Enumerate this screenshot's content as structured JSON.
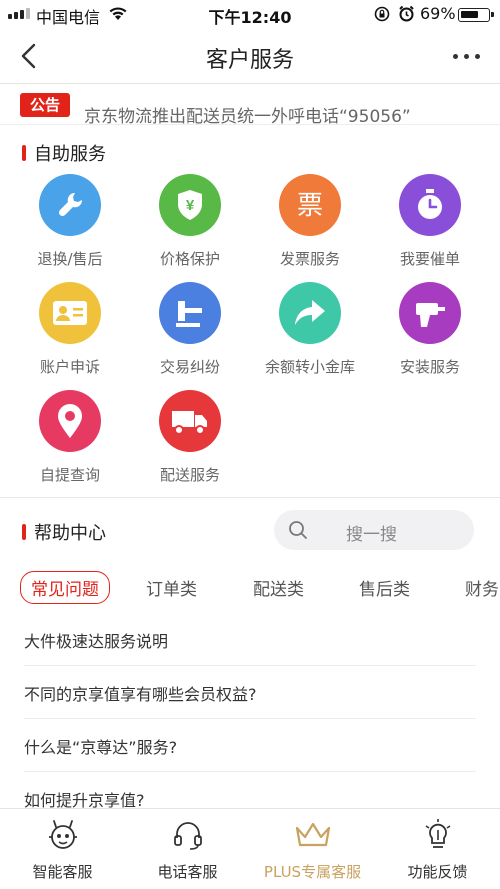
{
  "status_bar": {
    "carrier": "中国电信",
    "time": "下午12:40",
    "battery_percent": "69%",
    "battery_level": 0.69
  },
  "nav": {
    "title": "客户服务"
  },
  "notice": {
    "badge": "公告",
    "text": "京东物流推出配送员统一外呼电话“95056”"
  },
  "self_service": {
    "title": "自助服务",
    "items": [
      {
        "label": "退换/售后",
        "icon": "wrench-icon",
        "color": "#4aa3e8"
      },
      {
        "label": "价格保护",
        "icon": "shield-yen-icon",
        "color": "#58b947"
      },
      {
        "label": "发票服务",
        "icon": "ticket-icon",
        "color": "#ef7a3a"
      },
      {
        "label": "我要催单",
        "icon": "stopwatch-icon",
        "color": "#8a4fd8"
      },
      {
        "label": "账户申诉",
        "icon": "id-card-icon",
        "color": "#f0c23c"
      },
      {
        "label": "交易纠纷",
        "icon": "gavel-icon",
        "color": "#4b7fe0"
      },
      {
        "label": "余额转小金库",
        "icon": "share-arrow-icon",
        "color": "#3fc8a8"
      },
      {
        "label": "安装服务",
        "icon": "drill-icon",
        "color": "#a83cc0"
      },
      {
        "label": "自提查询",
        "icon": "location-pin-icon",
        "color": "#e63a63"
      },
      {
        "label": "配送服务",
        "icon": "truck-icon",
        "color": "#e6373a"
      }
    ]
  },
  "help_center": {
    "title": "帮助中心",
    "search_placeholder": "搜一搜",
    "tabs": [
      "常见问题",
      "订单类",
      "配送类",
      "售后类",
      "财务"
    ],
    "faqs": [
      "大件极速达服务说明",
      "不同的京享值享有哪些会员权益?",
      "什么是“京尊达”服务?",
      "如何提升京享值?"
    ]
  },
  "bottom_tabs": [
    {
      "label": "智能客服",
      "icon": "robot-icon"
    },
    {
      "label": "电话客服",
      "icon": "headset-icon"
    },
    {
      "label": "PLUS专属客服",
      "icon": "crown-icon"
    },
    {
      "label": "功能反馈",
      "icon": "lightbulb-icon"
    }
  ]
}
